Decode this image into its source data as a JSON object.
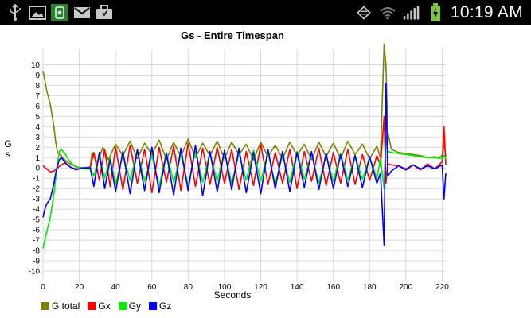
{
  "status_bar": {
    "time": "10:19 AM",
    "icons_left": [
      "usb-icon",
      "gallery-icon",
      "sensor-app-icon",
      "gmail-icon",
      "briefcase-icon"
    ],
    "icons_right": [
      "data-sync-icon",
      "wifi-icon",
      "signal-icon",
      "battery-charging-icon"
    ]
  },
  "chart_data": {
    "type": "line",
    "title": "Gs - Entire Timespan",
    "xlabel": "Seconds",
    "ylabel": "G\ns",
    "xlim": [
      0,
      222
    ],
    "ylim": [
      -11,
      11.5
    ],
    "x_ticks": [
      0,
      20,
      40,
      60,
      80,
      100,
      120,
      140,
      160,
      180,
      200,
      220
    ],
    "y_ticks": [
      10,
      9,
      8,
      7,
      6,
      5,
      4,
      3,
      2,
      1,
      0,
      -1,
      -2,
      -3,
      -4,
      -5,
      -6,
      -7,
      -8,
      -9,
      -10
    ],
    "grid": true,
    "legend_position": "bottom-left",
    "series": [
      {
        "name": "G total",
        "color": "#808000",
        "points": [
          [
            0,
            9.4
          ],
          [
            1,
            8.5
          ],
          [
            2,
            7.5
          ],
          [
            4,
            6.2
          ],
          [
            6,
            4.0
          ],
          [
            7,
            2.5
          ],
          [
            8,
            1.5
          ],
          [
            9,
            1.3
          ],
          [
            10,
            1.2
          ],
          [
            12,
            0.8
          ],
          [
            14,
            0.5
          ],
          [
            16,
            0.3
          ],
          [
            18,
            0.15
          ],
          [
            20,
            0.05
          ],
          [
            22,
            0.0
          ],
          [
            24,
            0.05
          ],
          [
            26,
            0.1
          ],
          [
            27,
            1.5
          ],
          [
            30,
            0.5
          ],
          [
            33,
            2.0
          ],
          [
            36,
            0.8
          ],
          [
            40,
            2.3
          ],
          [
            44,
            1.2
          ],
          [
            48,
            2.6
          ],
          [
            52,
            0.9
          ],
          [
            56,
            2.4
          ],
          [
            60,
            1.3
          ],
          [
            64,
            2.7
          ],
          [
            68,
            0.8
          ],
          [
            72,
            2.5
          ],
          [
            76,
            1.1
          ],
          [
            80,
            2.8
          ],
          [
            84,
            1.0
          ],
          [
            88,
            2.4
          ],
          [
            92,
            1.2
          ],
          [
            96,
            2.6
          ],
          [
            100,
            0.9
          ],
          [
            104,
            2.5
          ],
          [
            108,
            1.3
          ],
          [
            112,
            2.3
          ],
          [
            116,
            0.8
          ],
          [
            120,
            2.5
          ],
          [
            124,
            1.1
          ],
          [
            128,
            2.2
          ],
          [
            132,
            0.9
          ],
          [
            136,
            2.5
          ],
          [
            140,
            1.2
          ],
          [
            144,
            2.3
          ],
          [
            148,
            0.8
          ],
          [
            152,
            2.5
          ],
          [
            156,
            1.1
          ],
          [
            160,
            2.4
          ],
          [
            164,
            0.9
          ],
          [
            168,
            2.6
          ],
          [
            172,
            1.3
          ],
          [
            176,
            2.3
          ],
          [
            180,
            0.9
          ],
          [
            184,
            2.1
          ],
          [
            186,
            1.0
          ],
          [
            188,
            12.0
          ],
          [
            189,
            10.0
          ],
          [
            190,
            3.5
          ],
          [
            192,
            1.8
          ],
          [
            196,
            1.5
          ],
          [
            200,
            1.4
          ],
          [
            204,
            1.3
          ],
          [
            208,
            1.2
          ],
          [
            212,
            1.0
          ],
          [
            216,
            1.1
          ],
          [
            218,
            1.0
          ],
          [
            220,
            1.2
          ],
          [
            221,
            2.5
          ],
          [
            222,
            1.0
          ]
        ]
      },
      {
        "name": "Gx",
        "color": "#ff0000",
        "points": [
          [
            0,
            0.2
          ],
          [
            2,
            -0.1
          ],
          [
            4,
            -0.4
          ],
          [
            6,
            -0.3
          ],
          [
            8,
            0.0
          ],
          [
            10,
            0.3
          ],
          [
            12,
            0.5
          ],
          [
            14,
            0.2
          ],
          [
            16,
            0.0
          ],
          [
            18,
            -0.2
          ],
          [
            20,
            -0.1
          ],
          [
            22,
            0.0
          ],
          [
            26,
            0.0
          ],
          [
            28,
            1.5
          ],
          [
            31,
            -1.2
          ],
          [
            34,
            1.8
          ],
          [
            37,
            -1.8
          ],
          [
            40,
            2.0
          ],
          [
            44,
            -2.1
          ],
          [
            48,
            2.2
          ],
          [
            52,
            -1.5
          ],
          [
            56,
            1.8
          ],
          [
            60,
            -2.4
          ],
          [
            64,
            2.0
          ],
          [
            68,
            -1.4
          ],
          [
            72,
            2.1
          ],
          [
            76,
            -2.2
          ],
          [
            80,
            2.4
          ],
          [
            84,
            -1.8
          ],
          [
            88,
            1.9
          ],
          [
            92,
            -1.6
          ],
          [
            96,
            2.0
          ],
          [
            100,
            -1.5
          ],
          [
            104,
            1.8
          ],
          [
            108,
            -2.1
          ],
          [
            112,
            1.6
          ],
          [
            116,
            -1.7
          ],
          [
            120,
            2.3
          ],
          [
            124,
            -1.6
          ],
          [
            128,
            1.5
          ],
          [
            132,
            -1.5
          ],
          [
            136,
            1.8
          ],
          [
            140,
            -2.0
          ],
          [
            144,
            1.6
          ],
          [
            148,
            -1.3
          ],
          [
            152,
            1.9
          ],
          [
            156,
            -1.7
          ],
          [
            160,
            1.5
          ],
          [
            164,
            -1.5
          ],
          [
            168,
            1.8
          ],
          [
            172,
            -1.6
          ],
          [
            176,
            1.3
          ],
          [
            180,
            -1.2
          ],
          [
            184,
            1.2
          ],
          [
            186,
            0.2
          ],
          [
            188,
            5.0
          ],
          [
            189,
            -1.5
          ],
          [
            190,
            0.4
          ],
          [
            192,
            0.3
          ],
          [
            196,
            0.2
          ],
          [
            200,
            -0.1
          ],
          [
            204,
            0.3
          ],
          [
            208,
            -0.2
          ],
          [
            212,
            0.4
          ],
          [
            216,
            -0.1
          ],
          [
            220,
            0.6
          ],
          [
            221,
            4.0
          ],
          [
            222,
            0.3
          ]
        ]
      },
      {
        "name": "Gy",
        "color": "#00ee00",
        "points": [
          [
            0,
            -7.8
          ],
          [
            1,
            -7.0
          ],
          [
            2,
            -6.2
          ],
          [
            4,
            -4.8
          ],
          [
            6,
            -2.5
          ],
          [
            7,
            -1.0
          ],
          [
            8,
            0.5
          ],
          [
            9,
            1.6
          ],
          [
            10,
            1.8
          ],
          [
            12,
            1.4
          ],
          [
            14,
            0.8
          ],
          [
            16,
            0.4
          ],
          [
            18,
            0.1
          ],
          [
            20,
            0.0
          ],
          [
            22,
            -0.1
          ],
          [
            26,
            -0.1
          ],
          [
            28,
            -0.8
          ],
          [
            31,
            1.2
          ],
          [
            34,
            -1.0
          ],
          [
            37,
            1.0
          ],
          [
            40,
            -1.6
          ],
          [
            44,
            1.3
          ],
          [
            48,
            -1.2
          ],
          [
            52,
            1.6
          ],
          [
            56,
            -1.3
          ],
          [
            60,
            1.2
          ],
          [
            64,
            -1.8
          ],
          [
            68,
            1.5
          ],
          [
            72,
            -1.4
          ],
          [
            76,
            1.3
          ],
          [
            80,
            -1.7
          ],
          [
            84,
            1.6
          ],
          [
            88,
            -1.4
          ],
          [
            92,
            1.5
          ],
          [
            96,
            -1.3
          ],
          [
            100,
            1.6
          ],
          [
            104,
            -1.5
          ],
          [
            108,
            1.4
          ],
          [
            112,
            -1.2
          ],
          [
            116,
            1.7
          ],
          [
            120,
            -1.3
          ],
          [
            124,
            1.5
          ],
          [
            128,
            -1.6
          ],
          [
            132,
            1.3
          ],
          [
            136,
            -1.4
          ],
          [
            140,
            1.6
          ],
          [
            144,
            -1.1
          ],
          [
            148,
            1.4
          ],
          [
            152,
            -1.5
          ],
          [
            156,
            1.3
          ],
          [
            160,
            -1.3
          ],
          [
            164,
            1.4
          ],
          [
            168,
            -1.2
          ],
          [
            172,
            1.2
          ],
          [
            176,
            -1.1
          ],
          [
            180,
            1.0
          ],
          [
            184,
            -1.0
          ],
          [
            186,
            0.9
          ],
          [
            188,
            -2.0
          ],
          [
            189,
            3.0
          ],
          [
            190,
            1.6
          ],
          [
            192,
            1.5
          ],
          [
            196,
            1.4
          ],
          [
            200,
            1.3
          ],
          [
            204,
            1.2
          ],
          [
            208,
            1.1
          ],
          [
            212,
            1.0
          ],
          [
            216,
            1.0
          ],
          [
            220,
            0.9
          ],
          [
            221,
            1.2
          ],
          [
            222,
            0.9
          ]
        ]
      },
      {
        "name": "Gz",
        "color": "#0000ff",
        "points": [
          [
            0,
            -4.8
          ],
          [
            1,
            -4.0
          ],
          [
            2,
            -3.5
          ],
          [
            4,
            -3.0
          ],
          [
            6,
            -1.5
          ],
          [
            7,
            -0.5
          ],
          [
            8,
            0.2
          ],
          [
            9,
            0.8
          ],
          [
            10,
            1.0
          ],
          [
            12,
            0.6
          ],
          [
            14,
            0.2
          ],
          [
            16,
            0.0
          ],
          [
            18,
            -0.1
          ],
          [
            20,
            -0.1
          ],
          [
            22,
            0.0
          ],
          [
            26,
            0.0
          ],
          [
            28,
            -1.8
          ],
          [
            31,
            1.5
          ],
          [
            34,
            -2.0
          ],
          [
            37,
            0.8
          ],
          [
            40,
            -2.3
          ],
          [
            44,
            1.6
          ],
          [
            48,
            -2.5
          ],
          [
            52,
            1.8
          ],
          [
            56,
            -2.2
          ],
          [
            60,
            2.0
          ],
          [
            64,
            -2.4
          ],
          [
            68,
            1.4
          ],
          [
            72,
            -2.6
          ],
          [
            76,
            1.9
          ],
          [
            80,
            -2.2
          ],
          [
            84,
            2.2
          ],
          [
            88,
            -2.7
          ],
          [
            92,
            1.6
          ],
          [
            96,
            -2.3
          ],
          [
            100,
            1.7
          ],
          [
            104,
            -2.1
          ],
          [
            108,
            1.9
          ],
          [
            112,
            -2.4
          ],
          [
            116,
            1.5
          ],
          [
            120,
            -2.5
          ],
          [
            124,
            1.8
          ],
          [
            128,
            -2.0
          ],
          [
            132,
            1.6
          ],
          [
            136,
            -2.3
          ],
          [
            140,
            1.5
          ],
          [
            144,
            -1.9
          ],
          [
            148,
            1.6
          ],
          [
            152,
            -2.1
          ],
          [
            156,
            1.4
          ],
          [
            160,
            -2.0
          ],
          [
            164,
            1.3
          ],
          [
            168,
            -1.8
          ],
          [
            172,
            1.2
          ],
          [
            176,
            -1.9
          ],
          [
            180,
            1.1
          ],
          [
            184,
            -1.5
          ],
          [
            186,
            -0.5
          ],
          [
            188,
            -7.5
          ],
          [
            189,
            8.2
          ],
          [
            190,
            -0.8
          ],
          [
            192,
            -0.3
          ],
          [
            196,
            0.2
          ],
          [
            200,
            -0.2
          ],
          [
            204,
            0.3
          ],
          [
            208,
            -0.1
          ],
          [
            212,
            0.2
          ],
          [
            216,
            -0.1
          ],
          [
            220,
            0.3
          ],
          [
            221,
            -3.0
          ],
          [
            222,
            -0.5
          ]
        ]
      }
    ]
  }
}
